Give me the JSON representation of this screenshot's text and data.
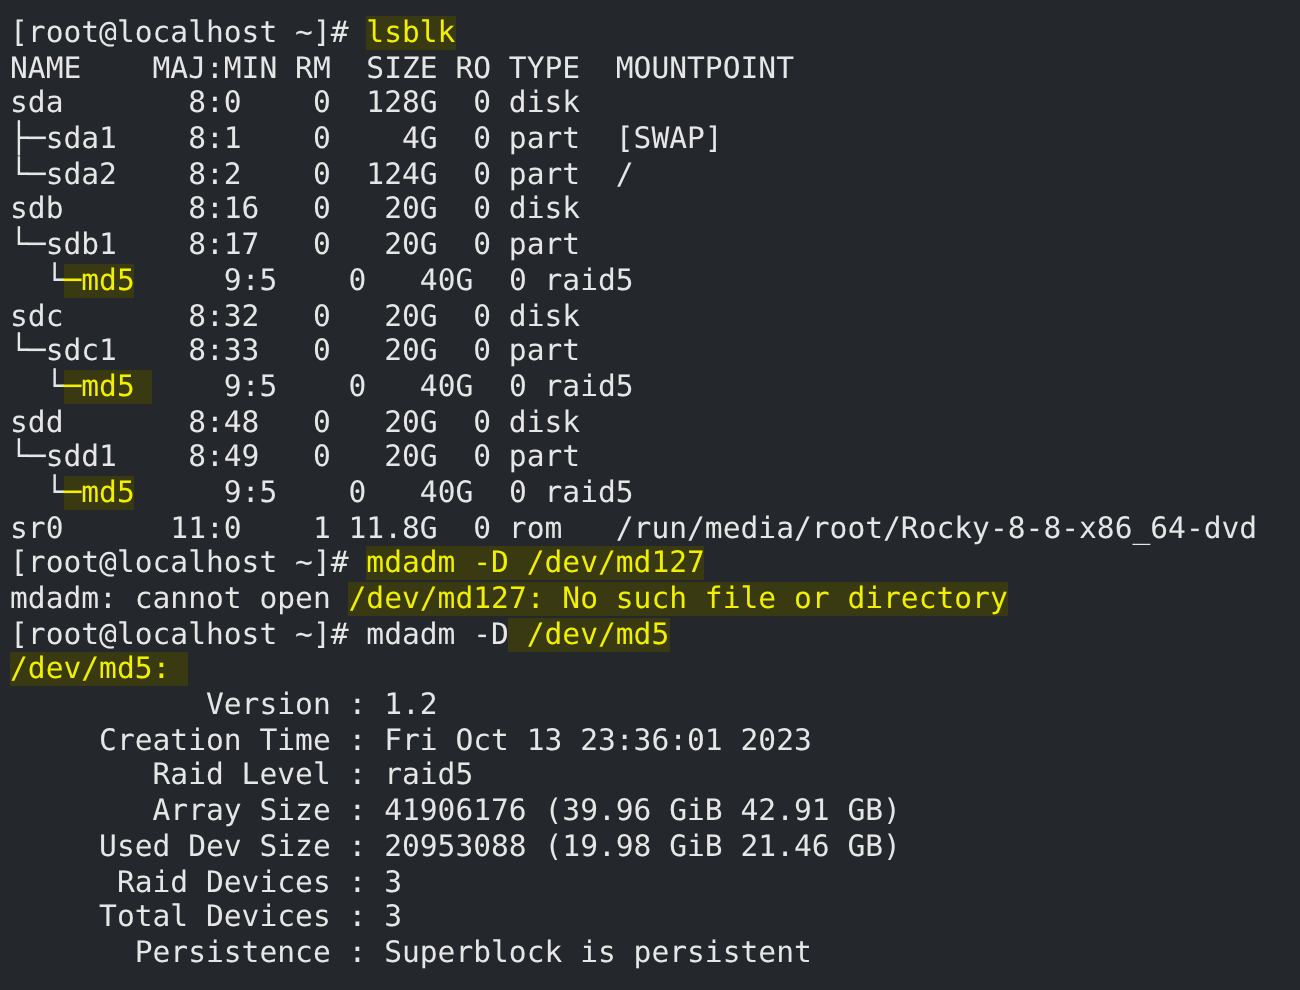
{
  "terminal": {
    "lines": [
      {
        "segments": [
          {
            "text": "[root@localhost ~]# ",
            "highlight": false
          },
          {
            "text": "lsblk",
            "highlight": true
          }
        ]
      },
      {
        "segments": [
          {
            "text": "NAME    MAJ:MIN RM  SIZE RO TYPE  MOUNTPOINT",
            "highlight": false
          }
        ]
      },
      {
        "segments": [
          {
            "text": "sda       8:0    0  128G  0 disk",
            "highlight": false
          }
        ]
      },
      {
        "segments": [
          {
            "text": "├─sda1    8:1    0    4G  0 part  [SWAP]",
            "highlight": false
          }
        ]
      },
      {
        "segments": [
          {
            "text": "└─sda2    8:2    0  124G  0 part  /",
            "highlight": false
          }
        ]
      },
      {
        "segments": [
          {
            "text": "sdb       8:16   0   20G  0 disk",
            "highlight": false
          }
        ]
      },
      {
        "segments": [
          {
            "text": "└─sdb1    8:17   0   20G  0 part",
            "highlight": false
          }
        ]
      },
      {
        "segments": [
          {
            "text": "  └",
            "highlight": false
          },
          {
            "text": "─md5",
            "highlight": true
          },
          {
            "text": "     9:5    0   40G  0 raid5",
            "highlight": false
          }
        ]
      },
      {
        "segments": [
          {
            "text": "sdc       8:32   0   20G  0 disk",
            "highlight": false
          }
        ]
      },
      {
        "segments": [
          {
            "text": "└─sdc1    8:33   0   20G  0 part",
            "highlight": false
          }
        ]
      },
      {
        "segments": [
          {
            "text": "  └",
            "highlight": false
          },
          {
            "text": "─md5 ",
            "highlight": true
          },
          {
            "text": "    9:5    0   40G  0 raid5",
            "highlight": false
          }
        ]
      },
      {
        "segments": [
          {
            "text": "sdd       8:48   0   20G  0 disk",
            "highlight": false
          }
        ]
      },
      {
        "segments": [
          {
            "text": "└─sdd1    8:49   0   20G  0 part",
            "highlight": false
          }
        ]
      },
      {
        "segments": [
          {
            "text": "  └",
            "highlight": false
          },
          {
            "text": "─md5",
            "highlight": true
          },
          {
            "text": "     9:5    0   40G  0 raid5",
            "highlight": false
          }
        ]
      },
      {
        "segments": [
          {
            "text": "sr0      11:0    1 11.8G  0 rom   /run/media/root/Rocky-8-8-x86_64-dvd",
            "highlight": false
          }
        ]
      },
      {
        "segments": [
          {
            "text": "[root@localhost ~]# ",
            "highlight": false
          },
          {
            "text": "mdadm -D /dev/md127",
            "highlight": true
          }
        ]
      },
      {
        "segments": [
          {
            "text": "mdadm: cannot open ",
            "highlight": false
          },
          {
            "text": "/dev/md127: No such file or directory",
            "highlight": true
          }
        ]
      },
      {
        "segments": [
          {
            "text": "[root@localhost ~]# mdadm -D",
            "highlight": false
          },
          {
            "text": " /dev/md5",
            "highlight": true
          }
        ]
      },
      {
        "segments": [
          {
            "text": "/dev/md5: ",
            "highlight": true
          }
        ]
      },
      {
        "segments": [
          {
            "text": "           Version : 1.2",
            "highlight": false
          }
        ]
      },
      {
        "segments": [
          {
            "text": "     Creation Time : Fri Oct 13 23:36:01 2023",
            "highlight": false
          }
        ]
      },
      {
        "segments": [
          {
            "text": "        Raid Level : raid5",
            "highlight": false
          }
        ]
      },
      {
        "segments": [
          {
            "text": "        Array Size : 41906176 (39.96 GiB 42.91 GB)",
            "highlight": false
          }
        ]
      },
      {
        "segments": [
          {
            "text": "     Used Dev Size : 20953088 (19.98 GiB 21.46 GB)",
            "highlight": false
          }
        ]
      },
      {
        "segments": [
          {
            "text": "      Raid Devices : 3",
            "highlight": false
          }
        ]
      },
      {
        "segments": [
          {
            "text": "     Total Devices : 3",
            "highlight": false
          }
        ]
      },
      {
        "segments": [
          {
            "text": "       Persistence : Superblock is persistent",
            "highlight": false
          }
        ]
      }
    ]
  }
}
